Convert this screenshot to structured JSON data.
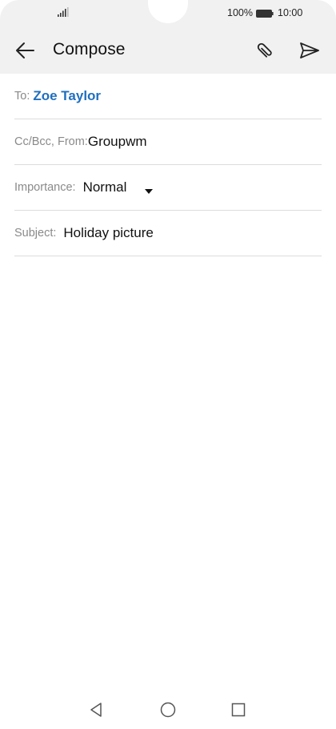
{
  "status_bar": {
    "battery_percent": "100%",
    "time": "10:00"
  },
  "app_bar": {
    "title": "Compose",
    "icons": [
      "back-arrow-icon",
      "paperclip-icon",
      "send-icon"
    ]
  },
  "form": {
    "to_label": "To:",
    "to_value": "Zoe Taylor",
    "cc_label": "Cc/Bcc, From:",
    "cc_value": "Groupwm",
    "importance_label": "Importance:",
    "importance_value": "Normal",
    "subject_label": "Subject:",
    "subject_value": "Holiday picture"
  },
  "body_text": "",
  "nav": {
    "icons": [
      "nav-back-icon",
      "nav-home-icon",
      "nav-recent-icon"
    ]
  },
  "colors": {
    "app_bar_bg": "#f1f1f1",
    "recipient_blue": "#1f6fbf",
    "label_gray": "#8a8a8a",
    "divider": "#dcdcdc"
  }
}
